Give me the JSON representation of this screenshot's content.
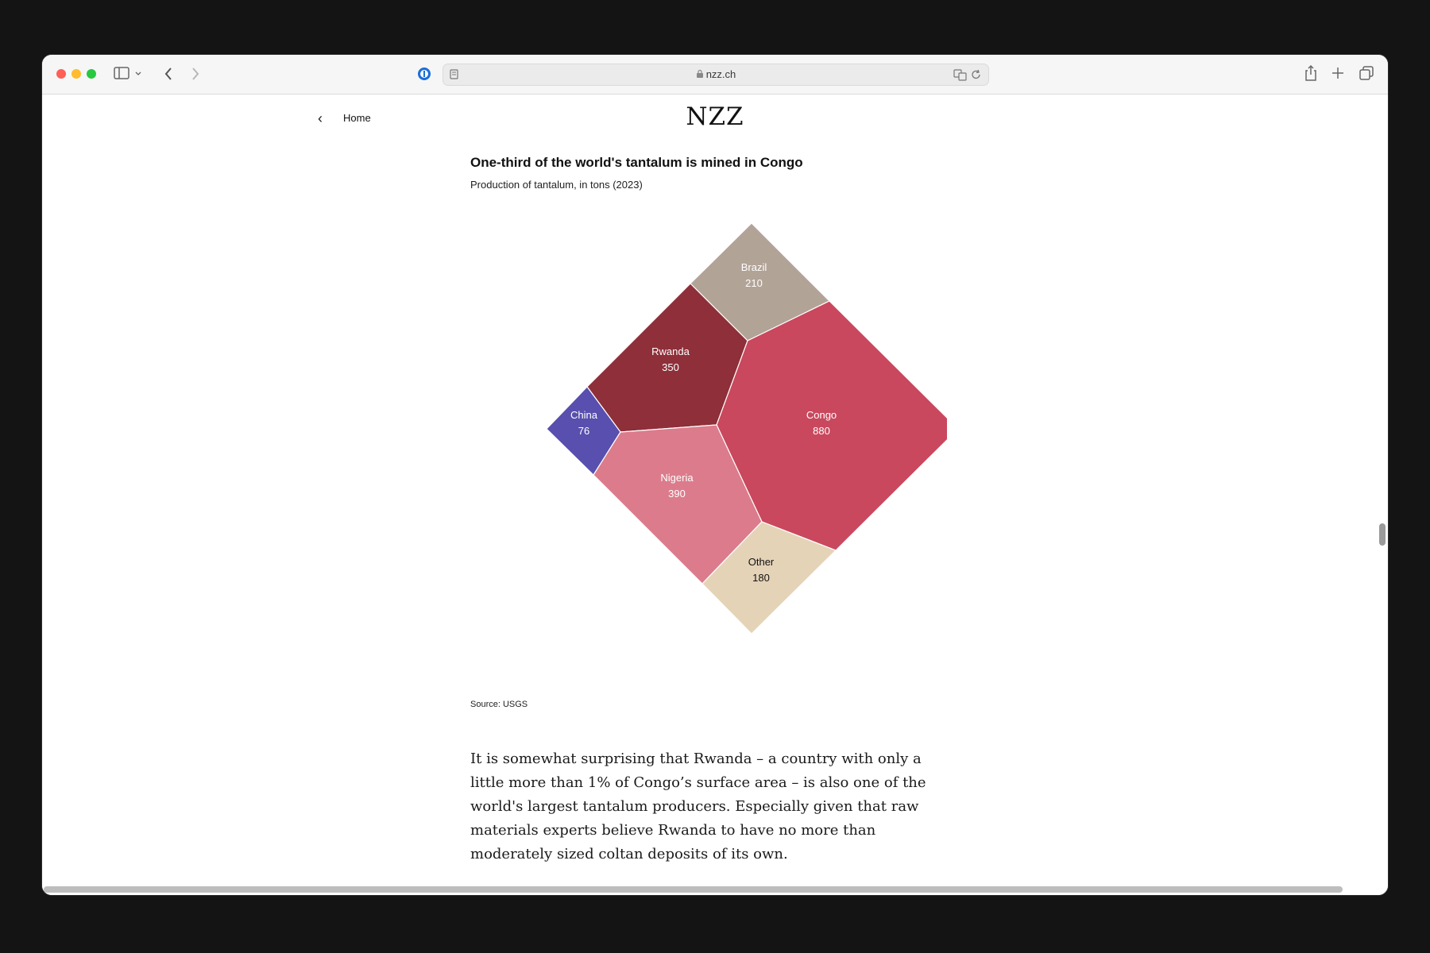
{
  "browser": {
    "url": "nzz.ch",
    "icons": {
      "sidebar": "sidebar-icon",
      "back": "chevron-left-icon",
      "forward": "chevron-right-icon",
      "password": "password-manager-icon",
      "reader": "reader-icon",
      "lock": "lock-icon",
      "translate": "translate-icon",
      "reload": "reload-icon",
      "share": "share-icon",
      "new_tab": "plus-icon",
      "tabs": "tabs-overview-icon"
    }
  },
  "page": {
    "nav": {
      "back_label": "Home",
      "logo": "NZZ"
    },
    "article_paragraph": "It is somewhat surprising that Rwanda – a country with only a little more than 1% of Congo’s surface area – is also one of the world's largest tantalum producers. Especially given that raw materials experts believe Rwanda to have no more than moderately sized coltan deposits of its own."
  },
  "chart_data": {
    "type": "treemap",
    "title": "One-third of the world's tantalum is mined in Congo",
    "subtitle": "Production of tantalum, in tons (2023)",
    "source": "Source: USGS",
    "categories": [
      "Brazil",
      "Rwanda",
      "China",
      "Congo",
      "Nigeria",
      "Other"
    ],
    "values": [
      210,
      350,
      76,
      880,
      390,
      180
    ],
    "colors": [
      "#b2a397",
      "#8e2f39",
      "#584fae",
      "#c9485d",
      "#dc7b8b",
      "#e5d3b8"
    ],
    "label_colors": [
      "#ffffff",
      "#ffffff",
      "#ffffff",
      "#ffffff",
      "#ffffff",
      "#111111"
    ]
  }
}
